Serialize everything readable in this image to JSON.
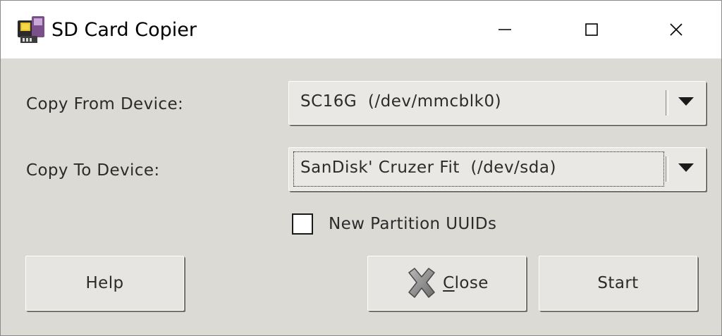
{
  "window": {
    "title": "SD Card Copier",
    "controls": {
      "minimize_icon": "minimize-icon",
      "maximize_icon": "maximize-icon",
      "close_icon": "close-icon"
    },
    "app_icon": "sd-card-icon"
  },
  "form": {
    "from_label": "Copy From Device:",
    "from_value": "SC16G  (/dev/mmcblk0)",
    "to_label": "Copy To Device:",
    "to_value": "SanDisk' Cruzer Fit  (/dev/sda)",
    "checkbox_label": "New Partition UUIDs",
    "checkbox_checked": false
  },
  "buttons": {
    "help": "Help",
    "close_mnemonic": "C",
    "close_rest": "lose",
    "start": "Start"
  },
  "colors": {
    "background": "#dcdad5",
    "titlebar": "#ffffff",
    "text": "#2b2b2b"
  }
}
